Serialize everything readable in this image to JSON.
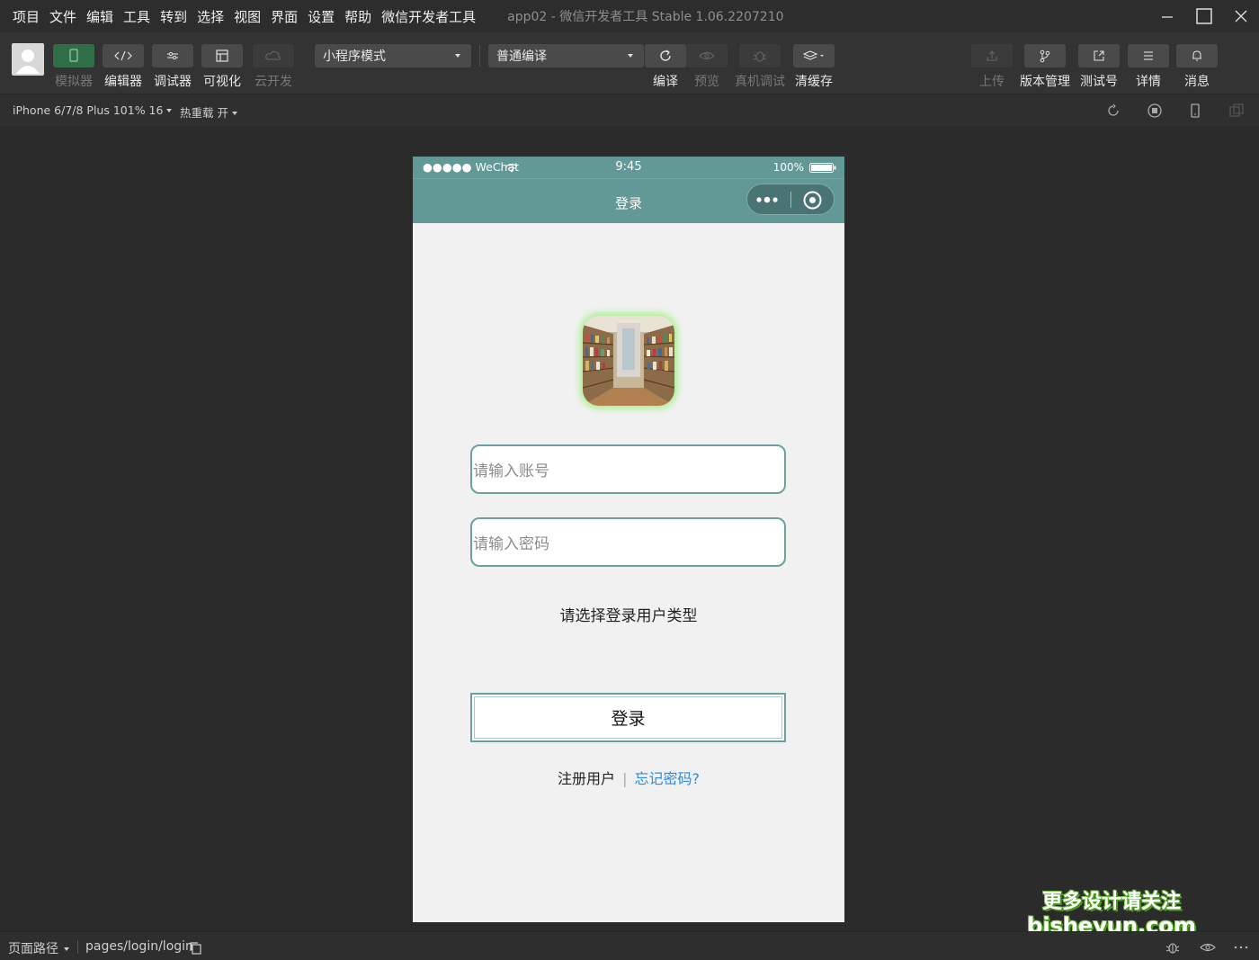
{
  "menubar": {
    "items": [
      "项目",
      "文件",
      "编辑",
      "工具",
      "转到",
      "选择",
      "视图",
      "界面",
      "设置",
      "帮助",
      "微信开发者工具"
    ],
    "window_title": "app02 - 微信开发者工具 Stable 1.06.2207210"
  },
  "toolbar": {
    "left_buttons": [
      {
        "label": "模拟器",
        "icon": "phone-icon",
        "state": "active"
      },
      {
        "label": "编辑器",
        "icon": "code-icon",
        "state": "normal"
      },
      {
        "label": "调试器",
        "icon": "debug-sliders-icon",
        "state": "normal"
      },
      {
        "label": "可视化",
        "icon": "layout-icon",
        "state": "normal"
      },
      {
        "label": "云开发",
        "icon": "cloud-icon",
        "state": "disabled"
      }
    ],
    "mode_select": "小程序模式",
    "compile_select": "普通编译",
    "center_buttons": [
      {
        "label": "编译",
        "icon": "refresh-icon",
        "state": "normal"
      },
      {
        "label": "预览",
        "icon": "eye-icon",
        "state": "disabled"
      },
      {
        "label": "真机调试",
        "icon": "bug-icon",
        "state": "disabled"
      },
      {
        "label": "清缓存",
        "icon": "layers-icon",
        "state": "normal"
      }
    ],
    "right_buttons": [
      {
        "label": "上传",
        "icon": "upload-icon",
        "state": "disabled"
      },
      {
        "label": "版本管理",
        "icon": "branch-icon",
        "state": "normal"
      },
      {
        "label": "测试号",
        "icon": "external-link-icon",
        "state": "normal"
      },
      {
        "label": "详情",
        "icon": "menu-icon",
        "state": "normal"
      },
      {
        "label": "消息",
        "icon": "bell-icon",
        "state": "normal"
      }
    ]
  },
  "subbar": {
    "device": "iPhone 6/7/8 Plus 101% 16",
    "hot_reload": "热重载 开"
  },
  "phone": {
    "status": {
      "carrier": "●●●●● WeChat",
      "time": "9:45",
      "battery": "100%"
    },
    "nav_title": "登录",
    "account_placeholder": "请输入账号",
    "password_placeholder": "请输入密码",
    "user_type_hint": "请选择登录用户类型",
    "login_button": "登录",
    "register_link": "注册用户",
    "forgot_link": "忘记密码?"
  },
  "bottombar": {
    "path_label": "页面路径",
    "path": "pages/login/login"
  },
  "watermark": {
    "line1": "更多设计请关注",
    "line2": "bisheyun.com"
  },
  "colors": {
    "nav_bg": "#629896",
    "input_border": "#6aa29f",
    "forgot_link": "#2b8de0",
    "simulator_active": "#2f6e49"
  }
}
